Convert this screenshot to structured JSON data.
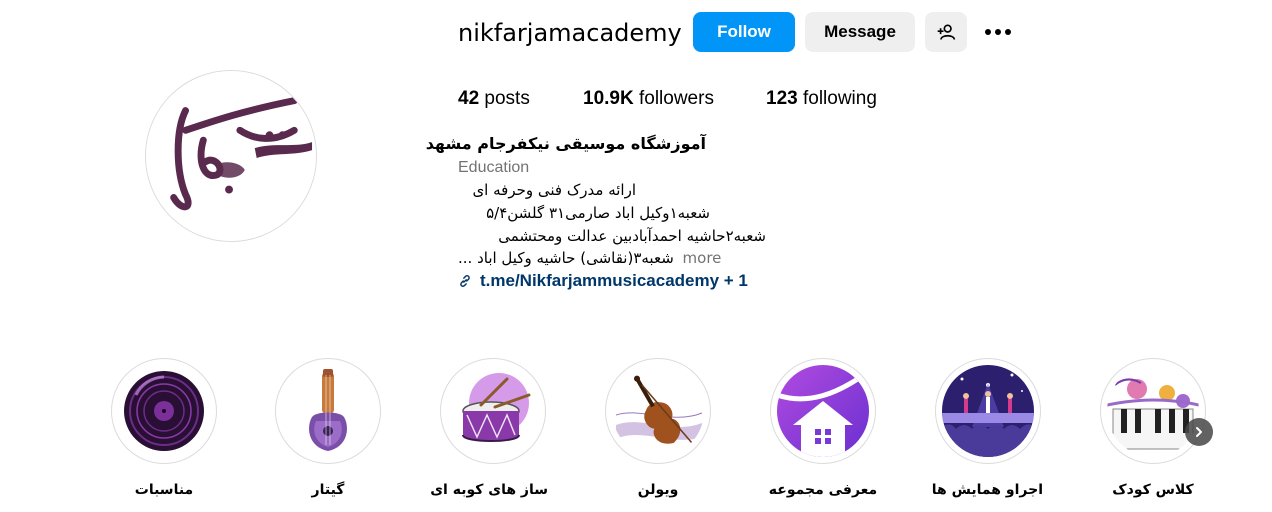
{
  "profile": {
    "username": "nikfarjamacademy",
    "follow_label": "Follow",
    "message_label": "Message",
    "stats": {
      "posts_count": "42",
      "posts_label": "posts",
      "followers_count": "10.9K",
      "followers_label": "followers",
      "following_count": "123",
      "following_label": "following"
    },
    "bio": {
      "name": "آموزشگاه موسیقی نیکفرجام مشهد",
      "category": "Education",
      "lines": [
        "ارائه مدرک فنی وحرفه ای",
        "شعبه۱وکیل اباد صارمی۳۱ گلشن۵/۴",
        "شعبه۲حاشیه احمدآبادبین عدالت ومحتشمی",
        "شعبه۳(نقاشی) حاشیه وکیل اباد ..."
      ],
      "more_label": "more",
      "link_text": "t.me/Nikfarjammusicacademy + 1"
    }
  },
  "highlights": [
    {
      "label": "مناسبات",
      "icon": "vinyl-record-icon"
    },
    {
      "label": "گیتار",
      "icon": "guitar-icon"
    },
    {
      "label": "ساز های کوبه ای",
      "icon": "drum-icon"
    },
    {
      "label": "ویولن",
      "icon": "violin-icon"
    },
    {
      "label": "معرفی مجموعه",
      "icon": "house-icon"
    },
    {
      "label": "اجراو همایش ها",
      "icon": "concert-stage-icon"
    },
    {
      "label": "کلاس کودک",
      "icon": "piano-kids-icon"
    }
  ],
  "colors": {
    "follow_button": "#0095f6",
    "secondary_button": "#efefef",
    "link": "#00376b",
    "muted_text": "#737373",
    "brand_purple": "#5a2a4e"
  }
}
